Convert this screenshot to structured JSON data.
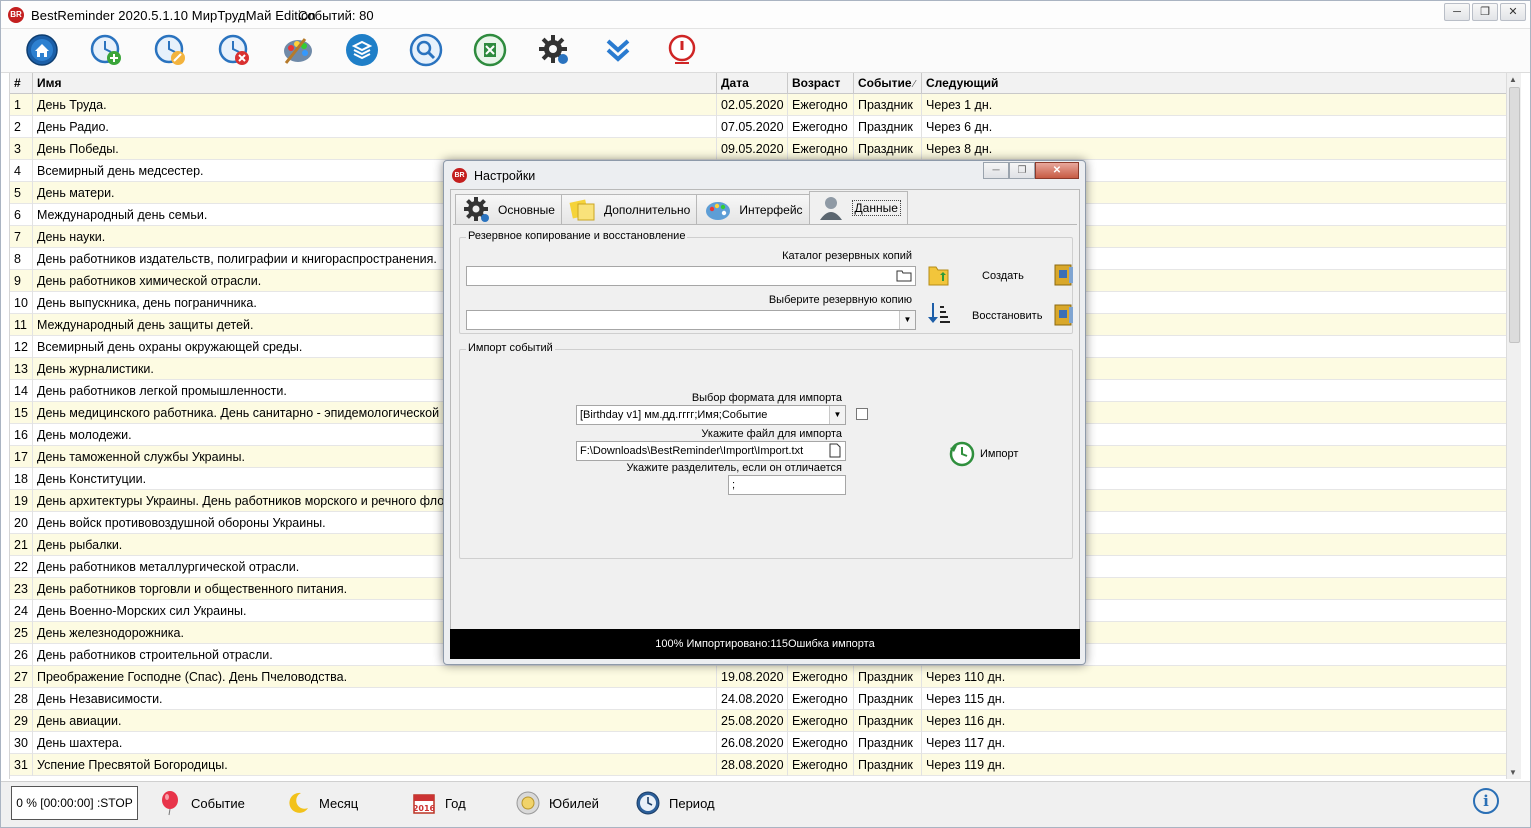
{
  "app": {
    "title": "BestReminder 2020.5.1.10 МирТрудМай Edition",
    "events_count": "Событий:  80",
    "icon_text": "BR"
  },
  "toolbar_icons": [
    "home-icon",
    "add-event-icon",
    "edit-event-icon",
    "delete-event-icon",
    "palette-icon",
    "layers-icon",
    "search-icon",
    "excel-icon",
    "settings-gear-icon",
    "collapse-down-icon",
    "power-off-icon"
  ],
  "grid": {
    "headers": {
      "num": "#",
      "name": "Имя",
      "date": "Дата",
      "age": "Возраст",
      "event": "Событие",
      "next": "Следующий"
    },
    "rows": [
      {
        "n": "1",
        "name": "День Труда.",
        "date": "02.05.2020",
        "age": "Ежегодно",
        "event": "Праздник",
        "next": "Через 1 дн."
      },
      {
        "n": "2",
        "name": "День Радио.",
        "date": "07.05.2020",
        "age": "Ежегодно",
        "event": "Праздник",
        "next": "Через 6 дн."
      },
      {
        "n": "3",
        "name": "День Победы.",
        "date": "09.05.2020",
        "age": "Ежегодно",
        "event": "Праздник",
        "next": "Через 8 дн."
      },
      {
        "n": "4",
        "name": "Всемирный день медсестер.",
        "date": "",
        "age": "",
        "event": "",
        "next": ""
      },
      {
        "n": "5",
        "name": "День матери.",
        "date": "",
        "age": "",
        "event": "",
        "next": ""
      },
      {
        "n": "6",
        "name": "Международный день семьи.",
        "date": "",
        "age": "",
        "event": "",
        "next": ""
      },
      {
        "n": "7",
        "name": "День науки.",
        "date": "",
        "age": "",
        "event": "",
        "next": ""
      },
      {
        "n": "8",
        "name": "День работников издательств, полиграфии и книгораспространения.",
        "date": "",
        "age": "",
        "event": "",
        "next": ""
      },
      {
        "n": "9",
        "name": "День работников химической отрасли.",
        "date": "",
        "age": "",
        "event": "",
        "next": ""
      },
      {
        "n": "10",
        "name": "День выпускника, день пограничника.",
        "date": "",
        "age": "",
        "event": "",
        "next": ""
      },
      {
        "n": "11",
        "name": "Международный день защиты детей.",
        "date": "",
        "age": "",
        "event": "",
        "next": ""
      },
      {
        "n": "12",
        "name": "Всемирный день охраны окружающей среды.",
        "date": "",
        "age": "",
        "event": "",
        "next": ""
      },
      {
        "n": "13",
        "name": "День журналистики.",
        "date": "",
        "age": "",
        "event": "",
        "next": ""
      },
      {
        "n": "14",
        "name": "День работников легкой промышленности.",
        "date": "",
        "age": "",
        "event": "",
        "next": ""
      },
      {
        "n": "15",
        "name": "День медицинского работника. День санитарно - эпидемологической службы.",
        "date": "",
        "age": "",
        "event": "",
        "next": ""
      },
      {
        "n": "16",
        "name": "День молодежи.",
        "date": "",
        "age": "",
        "event": "",
        "next": ""
      },
      {
        "n": "17",
        "name": "День таможенной службы Украины.",
        "date": "",
        "age": "",
        "event": "",
        "next": ""
      },
      {
        "n": "18",
        "name": "День Конституции.",
        "date": "",
        "age": "",
        "event": "",
        "next": ""
      },
      {
        "n": "19",
        "name": "День архитектуры Украины. День работников морского и речного флота.",
        "date": "",
        "age": "",
        "event": "",
        "next": ""
      },
      {
        "n": "20",
        "name": "День войск противовоздушной обороны Украины.",
        "date": "",
        "age": "",
        "event": "",
        "next": ""
      },
      {
        "n": "21",
        "name": "День рыбалки.",
        "date": "",
        "age": "",
        "event": "",
        "next": ""
      },
      {
        "n": "22",
        "name": "День работников металлургической отрасли.",
        "date": "",
        "age": "",
        "event": "",
        "next": ""
      },
      {
        "n": "23",
        "name": "День работников торговли и общественного питания.",
        "date": "",
        "age": "",
        "event": "",
        "next": ""
      },
      {
        "n": "24",
        "name": "День Военно-Морских сил Украины.",
        "date": "",
        "age": "",
        "event": "",
        "next": ""
      },
      {
        "n": "25",
        "name": "День железнодорожника.",
        "date": "",
        "age": "",
        "event": "",
        "next": ""
      },
      {
        "n": "26",
        "name": "День работников строительной отрасли.",
        "date": "",
        "age": "",
        "event": "",
        "next": ""
      },
      {
        "n": "27",
        "name": "Преображение Господне (Спас). День Пчеловодства.",
        "date": "19.08.2020",
        "age": "Ежегодно",
        "event": "Праздник",
        "next": "Через 110 дн."
      },
      {
        "n": "28",
        "name": "День Независимости.",
        "date": "24.08.2020",
        "age": "Ежегодно",
        "event": "Праздник",
        "next": "Через 115 дн."
      },
      {
        "n": "29",
        "name": "День авиации.",
        "date": "25.08.2020",
        "age": "Ежегодно",
        "event": "Праздник",
        "next": "Через 116 дн."
      },
      {
        "n": "30",
        "name": "День шахтера.",
        "date": "26.08.2020",
        "age": "Ежегодно",
        "event": "Праздник",
        "next": "Через 117 дн."
      },
      {
        "n": "31",
        "name": "Успение Пресвятой Богородицы.",
        "date": "28.08.2020",
        "age": "Ежегодно",
        "event": "Праздник",
        "next": "Через 119 дн."
      }
    ]
  },
  "statusbar": {
    "progress": "0 % [00:00:00] :STOP",
    "event": "Событие",
    "month": "Месяц",
    "year": "Год",
    "year_icon_text": "2016",
    "jubilee": "Юбилей",
    "period": "Период"
  },
  "dialog": {
    "title": "Настройки",
    "tabs": [
      "Основные",
      "Дополнительно",
      "Интерфейс",
      "Данные"
    ],
    "backup": {
      "group_title": "Резервное копирование и восстановление",
      "catalog_label": "Каталог резервных копий",
      "catalog_value": "",
      "create_label": "Создать",
      "select_label": "Выберите резервную копию",
      "select_value": "",
      "restore_label": "Восстановить"
    },
    "import": {
      "group_title": "Импорт событий",
      "format_label": "Выбор формата для импорта",
      "format_value": "[Birthday v1] мм.дд.гггг;Имя;Событие",
      "file_label": "Укажите файл для импорта",
      "file_value": "F:\\Downloads\\BestReminder\\Import\\Import.txt",
      "separator_label": "Укажите разделитель, если он отличается",
      "separator_value": ";",
      "import_button": "Импорт"
    },
    "status": "100% Импортировано:115Ошибка импорта"
  }
}
